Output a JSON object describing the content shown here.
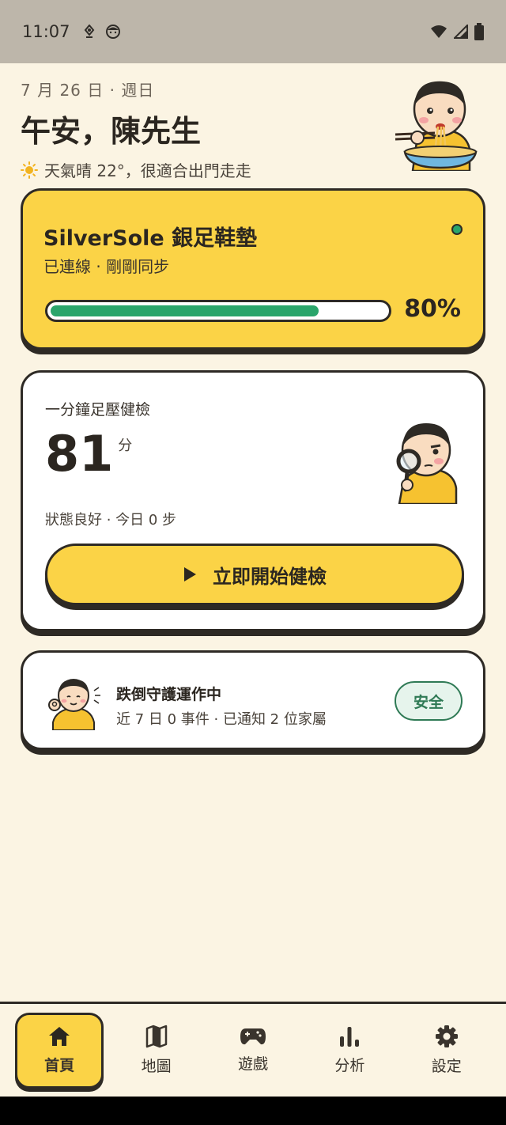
{
  "status_bar": {
    "time": "11:07",
    "icons": [
      "location-icon",
      "face-icon",
      "wifi-icon",
      "signal-icon",
      "battery-icon"
    ]
  },
  "header": {
    "date": "7 月 26 日 · 週日",
    "greeting": "午安，陳先生",
    "weather_icon": "sun-icon",
    "weather": "天氣晴 22°，很適合出門走走"
  },
  "device": {
    "name": "SilverSole 銀足鞋墊",
    "status": "已連線 · 剛剛同步",
    "battery_percent": 80,
    "battery_label": "80%",
    "online_color": "#2aa56b"
  },
  "health_check": {
    "title": "一分鐘足壓健檢",
    "score": "81",
    "unit": "分",
    "subtitle": "狀態良好 · 今日 0 步",
    "start_label": "立即開始健檢"
  },
  "fall_guard": {
    "title": "跌倒守護運作中",
    "subtitle": "近 7 日 0 事件 · 已通知 2 位家屬",
    "badge": "安全"
  },
  "nav": {
    "items": [
      {
        "label": "首頁",
        "icon": "home-icon",
        "active": true
      },
      {
        "label": "地圖",
        "icon": "map-icon",
        "active": false
      },
      {
        "label": "遊戲",
        "icon": "gamepad-icon",
        "active": false
      },
      {
        "label": "分析",
        "icon": "bar-chart-icon",
        "active": false
      },
      {
        "label": "設定",
        "icon": "gear-icon",
        "active": false
      }
    ]
  },
  "colors": {
    "accent": "#fbd346",
    "background": "#fbf4e3",
    "success": "#2aa56b",
    "outline": "#2e2a25"
  }
}
